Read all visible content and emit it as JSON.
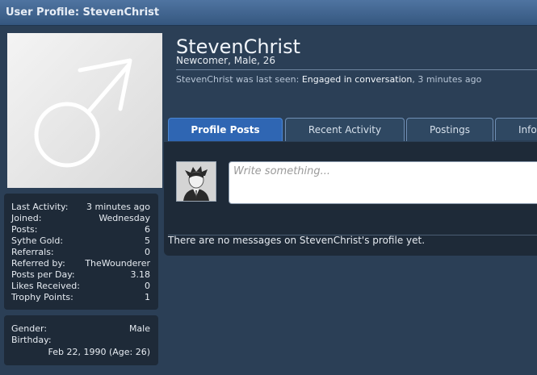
{
  "header": {
    "title": "User Profile: StevenChrist"
  },
  "profile": {
    "username": "StevenChrist",
    "user_title": "Newcomer, Male, 26",
    "last_seen_prefix": "StevenChrist was last seen:",
    "last_seen_activity": "Engaged in conversation",
    "last_seen_suffix": ", 3 minutes ago"
  },
  "stats": [
    {
      "label": "Last Activity:",
      "value": "3 minutes ago"
    },
    {
      "label": "Joined:",
      "value": "Wednesday"
    },
    {
      "label": "Posts:",
      "value": "6"
    },
    {
      "label": "Sythe Gold:",
      "value": "5"
    },
    {
      "label": "Referrals:",
      "value": "0"
    },
    {
      "label": "Referred by:",
      "value": "TheWounderer"
    },
    {
      "label": "Posts per Day:",
      "value": "3.18"
    },
    {
      "label": "Likes Received:",
      "value": "0"
    },
    {
      "label": "Trophy Points:",
      "value": "1"
    }
  ],
  "info": {
    "gender_label": "Gender:",
    "gender_value": "Male",
    "birthday_label": "Birthday:",
    "birthday_value": "Feb 22, 1990 (Age: 26)"
  },
  "tabs": [
    {
      "label": "Profile Posts",
      "active": true
    },
    {
      "label": "Recent Activity",
      "active": false
    },
    {
      "label": "Postings",
      "active": false
    },
    {
      "label": "Information",
      "active": false
    }
  ],
  "status": {
    "placeholder": "Write something..."
  },
  "empty_message": "There are no messages on StevenChrist's profile yet.",
  "icons": {
    "avatar": "male-symbol-avatar-icon",
    "poster": "user-avatar-icon"
  },
  "colors": {
    "accent": "#2f66b3",
    "panel": "#1e2a38",
    "background": "#2b3f56"
  }
}
